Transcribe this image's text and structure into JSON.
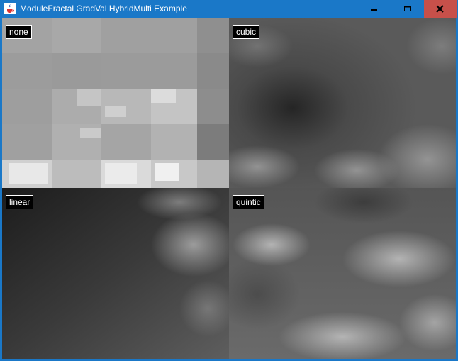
{
  "window": {
    "title": "ModuleFractal GradVal HybridMulti Example",
    "accent": "#1a78c8",
    "close_color": "#c7504a"
  },
  "controls": {
    "minimize_icon": "minimize-icon",
    "maximize_icon": "maximize-icon",
    "close_icon": "close-icon"
  },
  "panels": [
    {
      "label": "none"
    },
    {
      "label": "cubic"
    },
    {
      "label": "linear"
    },
    {
      "label": "quintic"
    }
  ]
}
